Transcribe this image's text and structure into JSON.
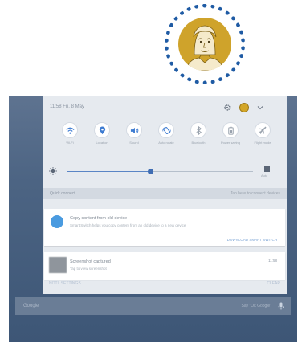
{
  "status_bar": {
    "time": "",
    "right": ""
  },
  "panel": {
    "datetime": "11:58 Fri, 8 May",
    "tiles": [
      {
        "name": "tile-wifi",
        "icon": "wifi-icon",
        "label": "Wi-Fi"
      },
      {
        "name": "tile-location",
        "icon": "location-icon",
        "label": "Location"
      },
      {
        "name": "tile-sound",
        "icon": "sound-icon",
        "label": "Sound"
      },
      {
        "name": "tile-rotate",
        "icon": "rotate-icon",
        "label": "Auto rotate"
      },
      {
        "name": "tile-bluetooth",
        "icon": "bluetooth-icon",
        "label": "Bluetooth"
      },
      {
        "name": "tile-power-saving",
        "icon": "battery-icon",
        "label": "Power saving"
      },
      {
        "name": "tile-airplane",
        "icon": "airplane-icon",
        "label": "Flight mode"
      }
    ],
    "brightness_level": 0.45,
    "auto_label": "Auto",
    "section_left": "Quick connect",
    "section_right": "Tap here to connect devices",
    "notifications": [
      {
        "title": "Copy content from old device",
        "body": "Smart Switch helps you copy content from an old device to a new device",
        "action": "DOWNLOAD SMART SWITCH"
      },
      {
        "title": "Screenshot captured",
        "body": "Tap to view screenshot",
        "time": "11:58"
      }
    ],
    "bottom_left": "NOTI. SETTINGS",
    "bottom_right": "CLEAR"
  },
  "search": {
    "placeholder": "Google",
    "right_hint": "Say \"Ok Google\""
  },
  "colors": {
    "accent": "#1f5ba4",
    "avatar": "#cfa32b",
    "panel_bg": "#e6eaef"
  }
}
